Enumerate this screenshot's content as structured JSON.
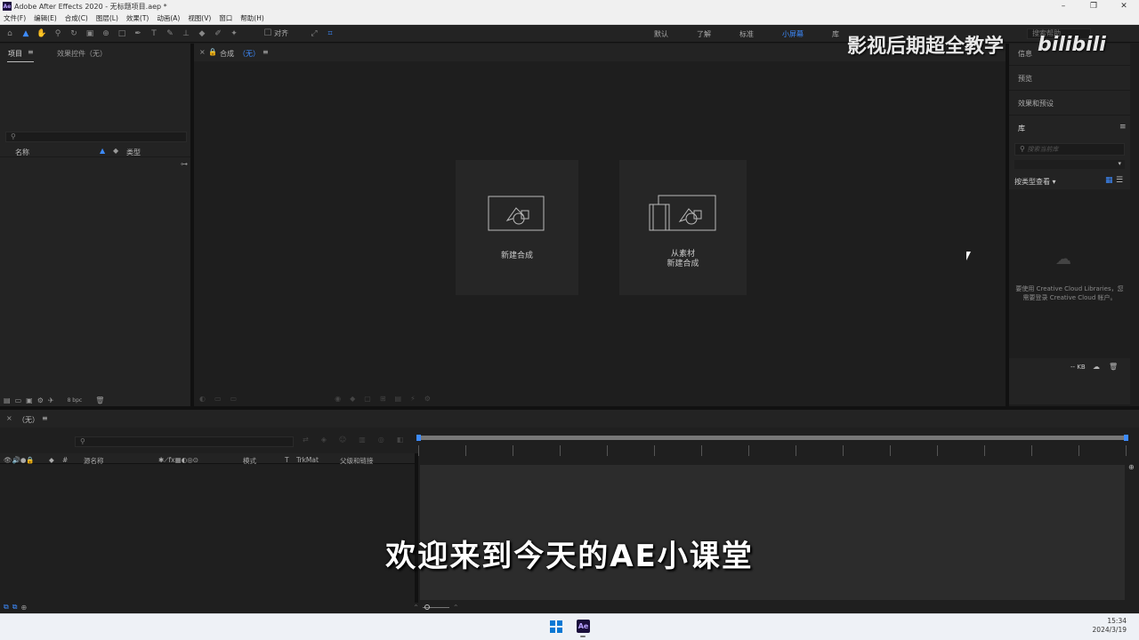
{
  "window": {
    "title": "Adobe After Effects 2020 - 无标题项目.aep *",
    "app_logo": "Ae"
  },
  "menu": [
    "文件(F)",
    "编辑(E)",
    "合成(C)",
    "图层(L)",
    "效果(T)",
    "动画(A)",
    "视图(V)",
    "窗口",
    "帮助(H)"
  ],
  "toolbar": {
    "snap_label": "对齐",
    "workspaces": [
      "默认",
      "了解",
      "标准",
      "小屏幕",
      "库"
    ],
    "active_workspace": "小屏幕",
    "search_help": "搜索帮助"
  },
  "project_panel": {
    "tab_project": "项目",
    "tab_effects": "效果控件（无）",
    "col_name": "名称",
    "col_type": "类型",
    "bpc": "8 bpc"
  },
  "comp_panel": {
    "tab_label": "合成",
    "tab_value": "（无）",
    "new_comp_label": "新建合成",
    "from_footage_line1": "从素材",
    "from_footage_line2": "新建合成"
  },
  "right_panel": {
    "info": "信息",
    "preview": "预览",
    "effects_presets": "效果和预设",
    "library": "库",
    "library_search_placeholder": "搜索当前库",
    "view_by_type": "按类型查看",
    "cc_message_line1": "要使用 Creative Cloud Libraries，您",
    "cc_message_line2": "需要登录 Creative Cloud 帐户。",
    "kb": "-- KB"
  },
  "timeline": {
    "tab_label": "（无）",
    "col_layer_name": "源名称",
    "col_mode": "模式",
    "col_trkmat": "TrkMat",
    "col_parent": "父级和链接",
    "col_number": "#"
  },
  "overlay": {
    "subtitle": "欢迎来到今天的AE小课堂",
    "watermark": "影视后期超全教学",
    "watermark_logo": "bilibili"
  },
  "taskbar": {
    "time": "15:34",
    "date": "2024/3/19",
    "app": "Ae"
  }
}
